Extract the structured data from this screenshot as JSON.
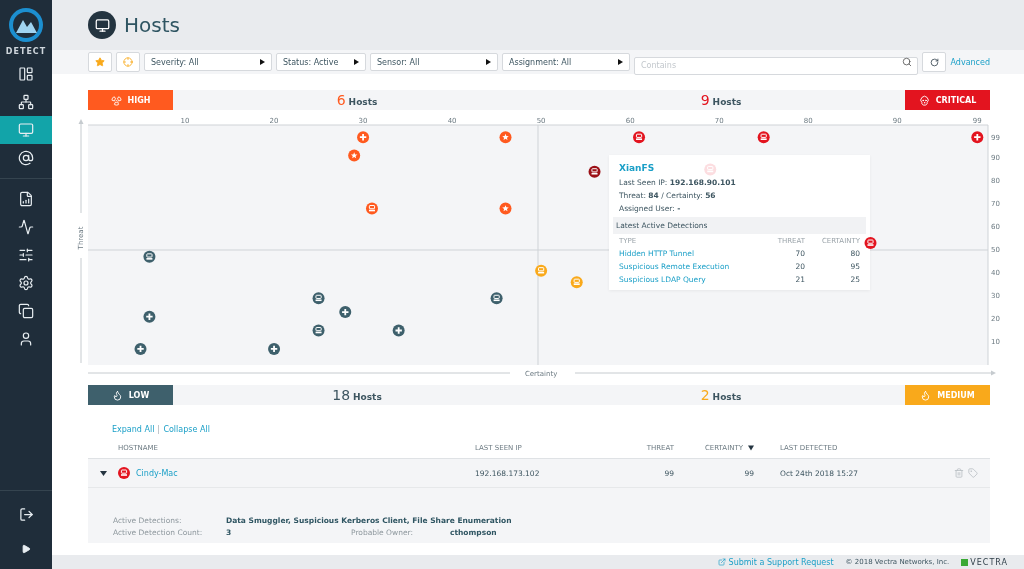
{
  "sidebar": {
    "section": "DETECT",
    "items": [
      {
        "selected": false
      },
      {
        "selected": false
      },
      {
        "selected": true
      },
      {
        "selected": false
      },
      {
        "selected": false
      },
      {
        "selected": false
      },
      {
        "selected": false
      },
      {
        "selected": false
      },
      {
        "selected": false
      },
      {
        "selected": false
      }
    ],
    "bottom_items": [
      {
        "selected": false
      },
      {
        "selected": false
      }
    ]
  },
  "header": {
    "title": "Hosts"
  },
  "filters": {
    "dropdowns": [
      "Severity: All",
      "Status: Active",
      "Sensor: All",
      "Assignment: All"
    ],
    "search": {
      "placeholder": "Contains"
    },
    "advanced": "Advanced"
  },
  "quadrants": {
    "high": {
      "label": "HIGH",
      "count": "6",
      "unit": "Hosts"
    },
    "critical": {
      "label": "CRITICAL",
      "count": "9",
      "unit": "Hosts"
    },
    "low": {
      "label": "LOW",
      "count": "18",
      "unit": "Hosts"
    },
    "medium": {
      "label": "MEDIUM",
      "count": "2",
      "unit": "Hosts"
    }
  },
  "chart": {
    "chart_data": {
      "type": "scatter",
      "xlabel": "Certainty",
      "xlim": [
        -0.9,
        100.2
      ],
      "ylim": [
        0,
        104.3
      ],
      "annotations": [
        "Threat"
      ],
      "xticks": [
        10,
        20,
        30,
        40,
        50,
        60,
        70,
        80,
        90,
        99
      ],
      "yticks": [
        10,
        20,
        30,
        40,
        50,
        60,
        70,
        80,
        90,
        99
      ],
      "x": [
        30,
        46,
        29,
        46,
        31,
        61,
        75,
        87,
        99,
        56,
        69,
        50,
        54,
        6,
        25,
        25,
        45,
        6,
        5,
        20,
        28,
        34
      ],
      "series": [
        {
          "color": "#ff5a1f",
          "values": [
            99,
            99,
            91,
            68,
            68,
            null,
            null,
            null,
            null,
            null,
            null,
            null,
            null,
            null,
            null,
            null,
            null,
            null,
            null,
            null,
            null,
            null
          ]
        },
        {
          "color": "#e3141f",
          "values": [
            null,
            null,
            null,
            null,
            null,
            99,
            99,
            53,
            99,
            null,
            null,
            null,
            null,
            null,
            null,
            null,
            null,
            null,
            null,
            null,
            null,
            null
          ]
        },
        {
          "color": "#9b1016",
          "values": [
            null,
            null,
            null,
            null,
            null,
            null,
            null,
            null,
            null,
            84,
            null,
            null,
            null,
            null,
            null,
            null,
            null,
            null,
            null,
            null,
            null,
            null
          ]
        },
        {
          "color": "#fcdde0",
          "values": [
            null,
            null,
            null,
            null,
            null,
            null,
            null,
            null,
            null,
            null,
            85,
            null,
            null,
            null,
            null,
            null,
            null,
            null,
            null,
            null,
            null,
            null
          ]
        },
        {
          "color": "#f9a91b",
          "values": [
            null,
            null,
            null,
            null,
            null,
            null,
            null,
            null,
            null,
            null,
            null,
            41,
            36,
            null,
            null,
            null,
            null,
            null,
            null,
            null,
            null,
            null
          ]
        },
        {
          "color": "#3e606c",
          "values": [
            null,
            null,
            null,
            null,
            null,
            null,
            null,
            null,
            null,
            null,
            null,
            null,
            null,
            47,
            29,
            15,
            29,
            21,
            7,
            7,
            23,
            15
          ]
        }
      ]
    },
    "markers": [
      {
        "kind": "plus"
      },
      {
        "kind": "star"
      },
      {
        "kind": "star"
      },
      {
        "kind": "star"
      },
      {
        "kind": "host"
      },
      {
        "kind": "host"
      },
      {
        "kind": "host"
      },
      {
        "kind": "host"
      },
      {
        "kind": "plus"
      },
      {
        "kind": "host"
      },
      {
        "kind": "host"
      },
      {
        "kind": "host"
      },
      {
        "kind": "host"
      },
      {
        "kind": "host"
      },
      {
        "kind": "host"
      },
      {
        "kind": "host"
      },
      {
        "kind": "host"
      },
      {
        "kind": "plus"
      },
      {
        "kind": "plus"
      },
      {
        "kind": "plus"
      },
      {
        "kind": "plus"
      },
      {
        "kind": "plus"
      }
    ],
    "tooltip": {
      "name": "XianFS",
      "fields": [
        {
          "label": "Last Seen IP:",
          "value": "192.168.90.101"
        },
        {
          "label": "Threat:",
          "value": "84",
          "label2": "/ Certainty:",
          "value2": "56"
        },
        {
          "label": "Assigned User:",
          "value": "-"
        }
      ],
      "section": "Latest Active Detections",
      "columns": [
        "TYPE",
        "THREAT",
        "CERTAINTY"
      ],
      "rows": [
        {
          "type": "Hidden HTTP Tunnel",
          "threat": "70",
          "certainty": "80"
        },
        {
          "type": "Suspicious Remote Execution",
          "threat": "20",
          "certainty": "95"
        },
        {
          "type": "Suspicious LDAP Query",
          "threat": "21",
          "certainty": "25"
        }
      ]
    }
  },
  "table": {
    "expand_all": "Expand All",
    "collapse_all": "Collapse All",
    "columns": [
      {
        "label": "HOSTNAME",
        "sorted": false
      },
      {
        "label": "LAST SEEN IP",
        "sorted": false
      },
      {
        "label": "THREAT",
        "sorted": false
      },
      {
        "label": "CERTAINTY",
        "sorted": true
      },
      {
        "label": "LAST DETECTED",
        "sorted": false
      }
    ],
    "rows": [
      {
        "expanded": true,
        "hostname": "Cindy-Mac",
        "ip": "192.168.173.102",
        "threat": "99",
        "certainty": "99",
        "last_detected": "Oct 24th 2018 15:27",
        "details": {
          "active_detections_label": "Active Detections:",
          "active_detections": "Data Smuggler, Suspicious Kerberos Client, File Share Enumeration",
          "count_label": "Active Detection Count:",
          "count": "3",
          "owner_label": "Probable Owner:",
          "owner": "cthompson"
        }
      }
    ]
  },
  "footer": {
    "support": "Submit a Support Request",
    "copyright": "© 2018 Vectra Networks, Inc.",
    "brand": "VECTRA"
  }
}
